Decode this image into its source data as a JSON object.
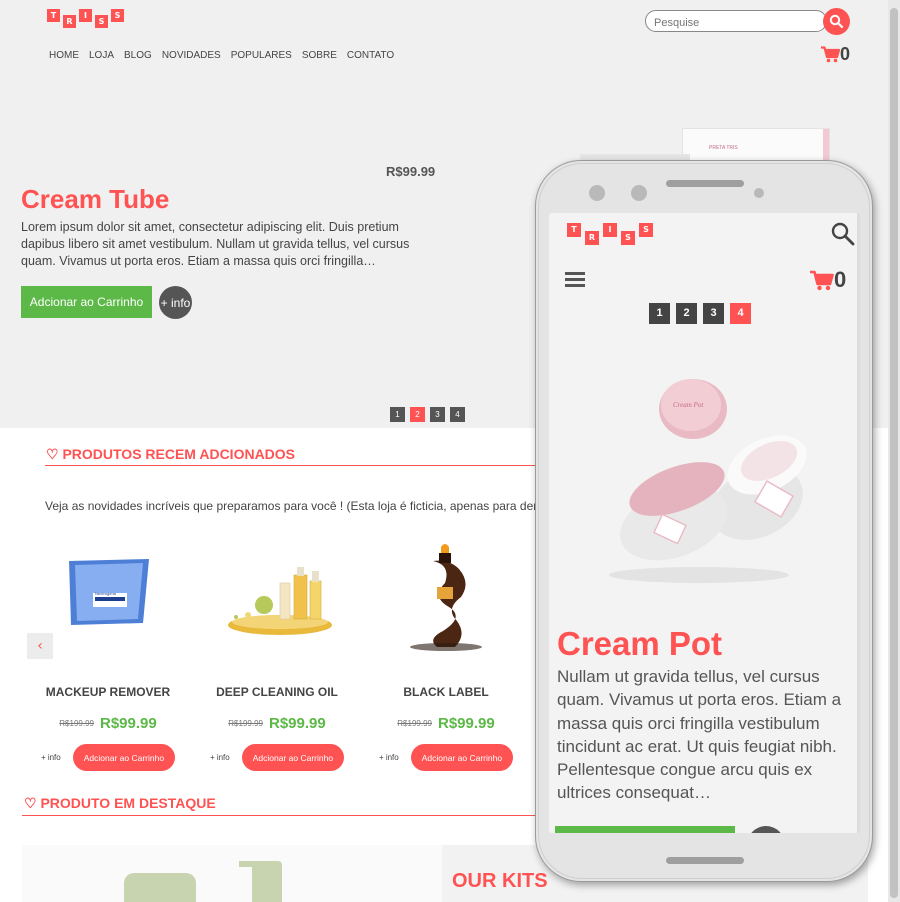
{
  "desktop": {
    "logo_letters": [
      "T",
      "R",
      "I",
      "S",
      "S"
    ],
    "nav": [
      "HOME",
      "LOJA",
      "BLOG",
      "NOVIDADES",
      "POPULARES",
      "SOBRE",
      "CONTATO"
    ],
    "search": {
      "placeholder": "Pesquise"
    },
    "cart_count": "0",
    "hero": {
      "price": "R$99.99",
      "title": "Cream Tube",
      "description": "Lorem ipsum dolor sit amet, consectetur adipiscing elit. Duis pretium dapibus libero sit amet vestibulum. Nullam ut gravida tellus, vel cursus quam. Vivamus ut porta eros. Etiam a massa quis orci fringilla…",
      "add_label": "Adcionar ao Carrinho",
      "info_label": "+ info",
      "box_text": "PRETA TRIS"
    },
    "slider_pages": [
      "1",
      "2",
      "3",
      "4"
    ],
    "slider_active": 1,
    "recent_section": {
      "title": "♡ PRODUTOS RECEM ADCIONADOS",
      "intro": "Veja as novidades incríveis que preparamos para você ! (Esta loja é ficticia, apenas para demonstração)"
    },
    "prev_arrow": "‹",
    "products": [
      {
        "name": "MACKEUP REMOVER",
        "old_price": "R$199.99",
        "price": "R$99.99",
        "info": "+ info",
        "add": "Adcionar ao Carrinho",
        "brand": "Neutrogena"
      },
      {
        "name": "DEEP CLEANING OIL",
        "old_price": "R$199.99",
        "price": "R$99.99",
        "info": "+ info",
        "add": "Adcionar ao Carrinho"
      },
      {
        "name": "BLACK LABEL",
        "old_price": "R$199.99",
        "price": "R$99.99",
        "info": "+ info",
        "add": "Adcionar ao Carrinho"
      }
    ],
    "featured_section": {
      "title": "♡ PRODUTO EM DESTAQUE",
      "kits": "OUR KITS"
    }
  },
  "mobile": {
    "logo_letters": [
      "T",
      "R",
      "I",
      "S",
      "S"
    ],
    "cart_count": "0",
    "slider_pages": [
      "1",
      "2",
      "3",
      "4"
    ],
    "slider_active": 3,
    "jar_label": "Cream Pot",
    "title": "Cream Pot",
    "description": "Nullam ut gravida tellus, vel cursus quam. Vivamus ut porta eros. Etiam a massa quis orci fringilla vestibulum tincidunt ac erat.  Ut quis feugiat nibh. Pellentesque congue arcu quis ex ultrices consequat…"
  },
  "colors": {
    "accent": "#ff5252",
    "green": "#5cb947",
    "dark": "#444444",
    "hero_bg": "#f0f0f0"
  },
  "icons": [
    "search-icon",
    "cart-icon",
    "menu-icon",
    "chevron-left-icon",
    "heart-icon"
  ]
}
